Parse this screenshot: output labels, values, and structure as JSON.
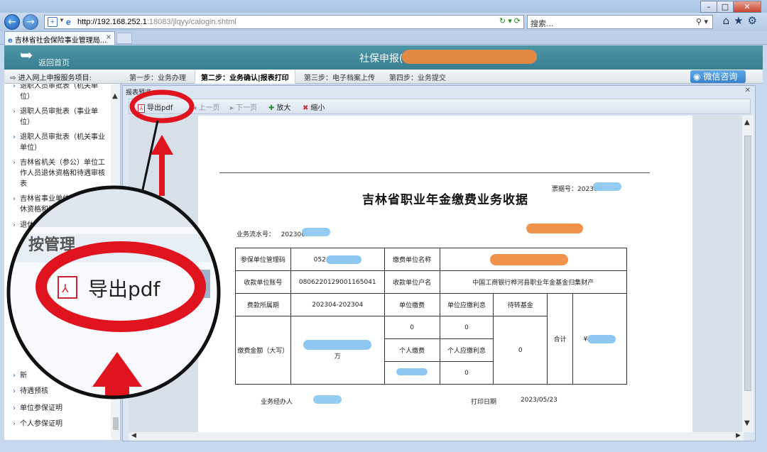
{
  "browser": {
    "url_host": "http://192.168.252.1",
    "url_rest": ":18083/jlqyy/calogin.shtml",
    "search_placeholder": "搜索...",
    "tab_title": "吉林省社会保险事业管理局...",
    "win_minimize": "–",
    "win_maximize": "□",
    "win_close": "✕"
  },
  "header": {
    "back_label": "返回首页",
    "title": "社保申报("
  },
  "steps": {
    "enter": "进入网上申报服务项目:",
    "items": [
      "第一步：业务办理",
      "第二步：业务确认|报表打印",
      "第三步：电子档案上传",
      "第四步：业务提交"
    ],
    "active_index": 1,
    "wechat": "微信咨询"
  },
  "sidebar": {
    "items": [
      "退职人员审批表（机关单位）",
      "退职人员审批表（事业单位）",
      "退职人员审批表（机关事业单位）",
      "吉林省机关（参公）单位工作人员退休资格和待遇审核表",
      "吉林省事业单位工作人员退休资格和待遇",
      "退休",
      "新",
      "待遇预核",
      "单位参保证明",
      "个人参保证明"
    ]
  },
  "report": {
    "frame_title": "报表预览",
    "toolbar": {
      "export_pdf": "导出pdf",
      "prev": "上一页",
      "next": "下一页",
      "zoom_in": "放大",
      "zoom_out": "缩小"
    },
    "doc": {
      "title": "吉林省职业年金缴费业务收据",
      "receipt_no_label": "票据号：",
      "receipt_no_prefix": "202300",
      "serial_label": "业务流水号：",
      "serial_prefix": "202300",
      "table": {
        "insured_unit_code_label": "参保单位管理码",
        "insured_unit_code_prefix": "052",
        "payer_name_label": "缴费单位名称",
        "account_no_label": "收款单位账号",
        "account_no": "0806220129001165041",
        "payee_name_label": "收款单位户名",
        "payee_name": "中国工商银行桦河县职业年金基金归集财产",
        "period_label": "费款所属期",
        "period": "202304-202304",
        "unit_pay_label": "单位缴费",
        "unit_interest_label": "单位应缴利息",
        "pending_fund_label": "待转基金",
        "total_label": "合计",
        "amount_label": "缴费金额（大写）",
        "amount_suffix": "万",
        "unit_pay": "0",
        "unit_interest": "0",
        "personal_pay_label": "个人缴费",
        "personal_interest_label": "个人应缴利息",
        "personal_interest": "0",
        "pending_fund": "0",
        "total_symbol": "¥"
      },
      "handler_label": "业务经办人",
      "print_date_label": "打印日期",
      "print_date": "2023/05/23"
    }
  },
  "callout": {
    "magnified_label": "导出pdf"
  },
  "colors": {
    "header_teal": "#3f8798",
    "annotation_red": "#e0141e",
    "redaction_blue": "#8ec8f0",
    "redaction_orange": "#f08a3c"
  }
}
